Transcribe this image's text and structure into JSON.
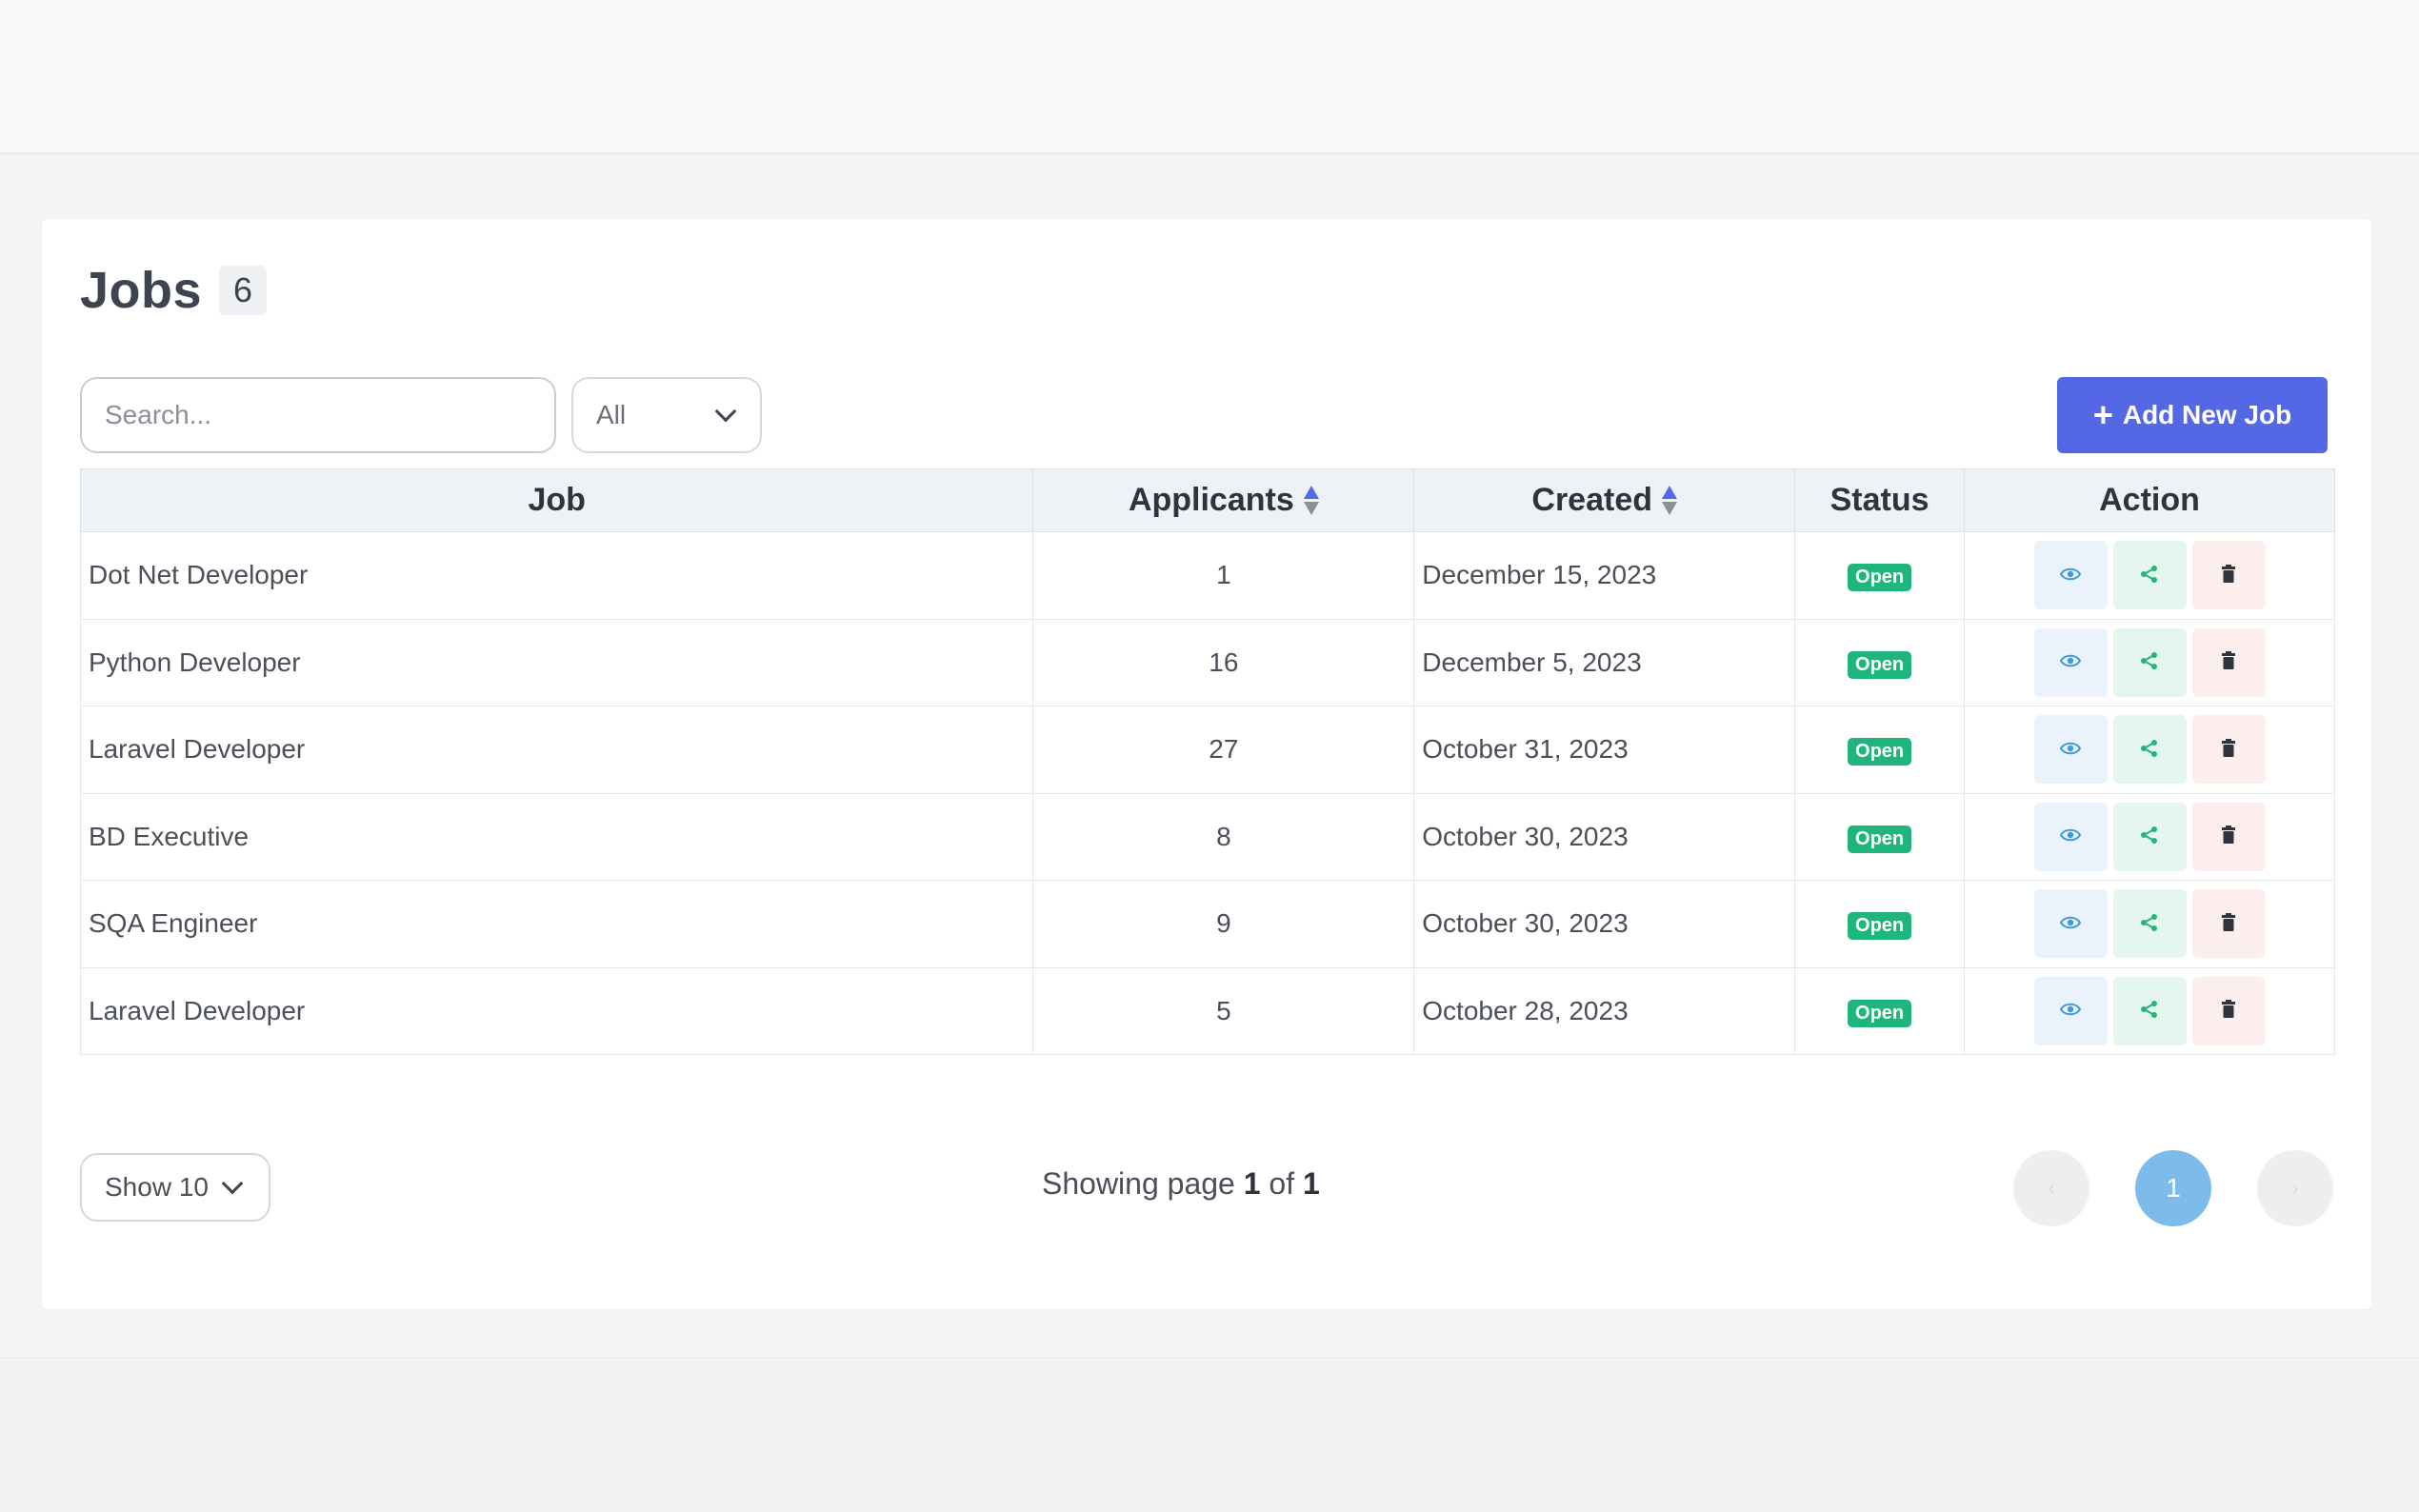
{
  "page": {
    "title": "Jobs",
    "count": "6"
  },
  "toolbar": {
    "search_placeholder": "Search...",
    "filter_value": "All",
    "add_button_label": "Add New Job",
    "add_icon": "plus-icon"
  },
  "table": {
    "columns": [
      "Job",
      "Applicants",
      "Created",
      "Status",
      "Action"
    ],
    "rows": [
      {
        "job": "Dot Net Developer",
        "applicants": "1",
        "created": "December 15, 2023",
        "status": "Open"
      },
      {
        "job": "Python Developer",
        "applicants": "16",
        "created": "December 5, 2023",
        "status": "Open"
      },
      {
        "job": "Laravel Developer",
        "applicants": "27",
        "created": "October 31, 2023",
        "status": "Open"
      },
      {
        "job": "BD Executive",
        "applicants": "8",
        "created": "October 30, 2023",
        "status": "Open"
      },
      {
        "job": "SQA Engineer",
        "applicants": "9",
        "created": "October 30, 2023",
        "status": "Open"
      },
      {
        "job": "Laravel Developer",
        "applicants": "5",
        "created": "October 28, 2023",
        "status": "Open"
      }
    ]
  },
  "pagination": {
    "page_size_label": "Show 10",
    "showing_prefix": "Showing page",
    "current": "1",
    "of_label": "of",
    "total": "1",
    "prev_label": "‹",
    "next_label": "›"
  },
  "colors": {
    "accent": "#5468e6",
    "open_badge": "#1fb57d",
    "current_page": "#7dbbea",
    "view_icon": "#3f9ad8",
    "share_icon": "#1fb57d",
    "delete_icon": "#2e343d"
  }
}
